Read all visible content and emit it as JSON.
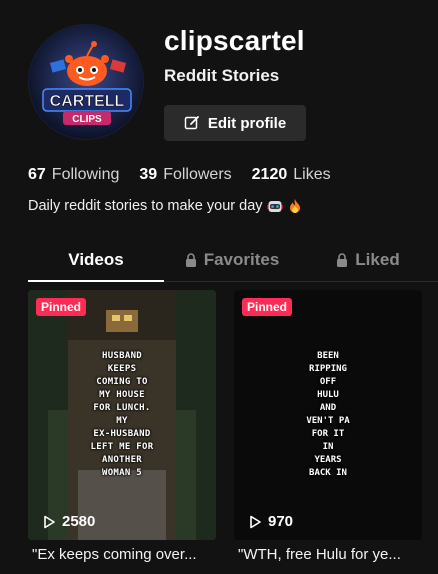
{
  "profile": {
    "username": "clipscartel",
    "display_name": "Reddit Stories",
    "avatar_text_top": "CARTELL",
    "avatar_text_bottom": "CLIPS",
    "edit_button_label": "Edit profile"
  },
  "stats": [
    {
      "count": "67",
      "label": "Following"
    },
    {
      "count": "39",
      "label": "Followers"
    },
    {
      "count": "2120",
      "label": "Likes"
    }
  ],
  "bio": {
    "text": "Daily reddit stories to make your day",
    "emojis": [
      "robot-face-icon",
      "fire-icon"
    ]
  },
  "tabs": [
    {
      "label": "Videos",
      "active": true,
      "locked": false
    },
    {
      "label": "Favorites",
      "active": false,
      "locked": true
    },
    {
      "label": "Liked",
      "active": false,
      "locked": true
    }
  ],
  "videos": [
    {
      "badge": "Pinned",
      "overlay_text": "HUSBAND\nKEEPS\nCOMING TO\nMY HOUSE\nFOR LUNCH.\nMY\nEX-HUSBAND\nLEFT ME FOR\nANOTHER\nWOMAN 5",
      "views": "2580",
      "caption": "\"Ex keeps coming over..."
    },
    {
      "badge": "Pinned",
      "overlay_text": "BEEN\nRIPPING\nOFF\nHULU\nAND\nVEN'T PA\nFOR IT\nIN\nYEARS\nBACK IN",
      "views": "970",
      "caption": "\"WTH, free Hulu for ye..."
    }
  ],
  "colors": {
    "background": "#121212",
    "pinned_badge": "#fe2c55",
    "button_bg": "#2b2b2b",
    "inactive_tab": "#8a8a8a"
  }
}
